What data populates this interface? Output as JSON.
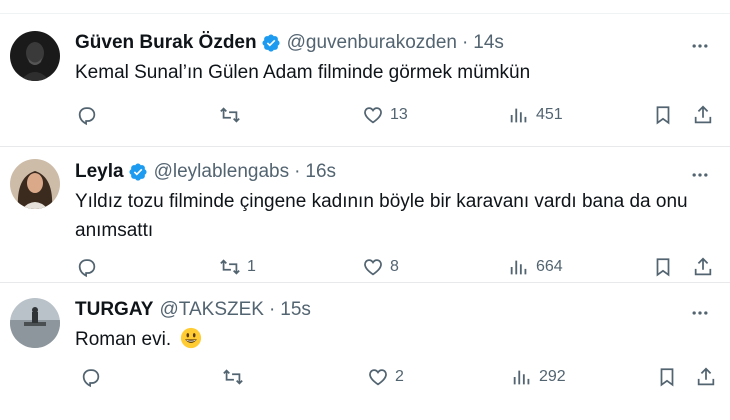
{
  "tweets": [
    {
      "name": "Güven Burak Özden",
      "verified": true,
      "handle": "@guvenburakozden",
      "time": "14s",
      "text_lines": [
        "Kemal Sunal’ın Gülen Adam filminde görmek mümkün"
      ],
      "replies": "",
      "retweets": "",
      "likes": "13",
      "views": "451"
    },
    {
      "name": "Leyla",
      "verified": true,
      "handle": "@leylablengabs",
      "time": "16s",
      "text_lines": [
        "Yıldız tozu filminde çingene kadının böyle bir karavanı vardı bana da onu",
        "anımsattı"
      ],
      "replies": "",
      "retweets": "1",
      "likes": "8",
      "views": "664"
    },
    {
      "name": "TURGAY",
      "verified": false,
      "handle": "@TAKSZEK",
      "time": "15s",
      "text_lines": [
        "Roman evi."
      ],
      "emoji": "grinning-face",
      "replies": "",
      "retweets": "",
      "likes": "2",
      "views": "292"
    }
  ],
  "separator": "·",
  "colors": {
    "verified": "#1d9bf0",
    "secondary_text": "#536471",
    "primary_text": "#0f1419",
    "divider": "#e7e9ea"
  },
  "icons": {
    "reply": "reply-icon",
    "retweet": "retweet-icon",
    "like": "heart-icon",
    "views": "views-icon",
    "bookmark": "bookmark-icon",
    "share": "share-icon",
    "more": "more-icon"
  }
}
